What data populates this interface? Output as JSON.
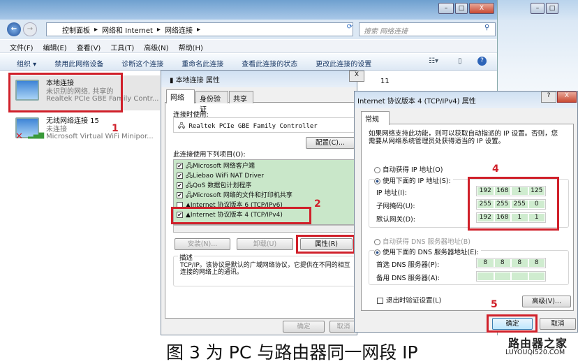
{
  "explorer": {
    "breadcrumb": [
      "控制面板",
      "网络和 Internet",
      "网络连接"
    ],
    "search_placeholder": "搜索 网络连接",
    "menu": [
      "文件(F)",
      "编辑(E)",
      "查看(V)",
      "工具(T)",
      "高级(N)",
      "帮助(H)"
    ],
    "toolbar": [
      "组织 ▾",
      "禁用此网络设备",
      "诊断这个连接",
      "重命名此连接",
      "查看此连接的状态",
      "更改此连接的设置"
    ],
    "connections": [
      {
        "name": "本地连接",
        "status": "未识别的网络, 共享的",
        "adapter": "Realtek PCIe GBE Family Contr..."
      },
      {
        "name": "无线网络连接 15",
        "status": "未连接",
        "adapter": "Microsoft Virtual WiFi Minipor..."
      }
    ],
    "partial_text": "11"
  },
  "properties_dialog": {
    "title": "本地连接 属性",
    "tabs": [
      "网络",
      "身份验证",
      "共享"
    ],
    "connect_using_label": "连接时使用:",
    "adapter": "Realtek PCIe GBE Family Controller",
    "configure_button": "配置(C)...",
    "items_label": "此连接使用下列项目(O):",
    "items": [
      {
        "label": "Microsoft 网络客户端",
        "checked": true
      },
      {
        "label": "Liebao WiFi NAT Driver",
        "checked": true
      },
      {
        "label": "QoS 数据包计划程序",
        "checked": true
      },
      {
        "label": "Microsoft 网络的文件和打印机共享",
        "checked": true
      },
      {
        "label": "Internet 协议版本 6 (TCP/IPv6)",
        "checked": false
      },
      {
        "label": "Internet 协议版本 4 (TCP/IPv4)",
        "checked": true
      }
    ],
    "install_button": "安装(N)...",
    "uninstall_button": "卸载(U)",
    "properties_button": "属性(R)",
    "description_label": "描述",
    "description": "TCP/IP。该协议是默认的广域网络协议，它提供在不同的相互连接的网络上的通讯。",
    "ok_button": "确定",
    "cancel_button": "取消"
  },
  "ipv4_dialog": {
    "title": "Internet 协议版本 4 (TCP/IPv4) 属性",
    "tab": "常规",
    "intro": "如果网络支持此功能，则可以获取自动指派的 IP 设置。否则，您需要从网络系统管理员处获得适当的 IP 设置。",
    "auto_ip": "自动获得 IP 地址(O)",
    "manual_ip": "使用下面的 IP 地址(S):",
    "ip_label": "IP 地址(I):",
    "ip": [
      "192",
      "168",
      "1",
      "125"
    ],
    "subnet_label": "子网掩码(U):",
    "subnet": [
      "255",
      "255",
      "255",
      "0"
    ],
    "gateway_label": "默认网关(D):",
    "gateway": [
      "192",
      "168",
      "1",
      "1"
    ],
    "auto_dns": "自动获得 DNS 服务器地址(B)",
    "manual_dns": "使用下面的 DNS 服务器地址(E):",
    "dns1_label": "首选 DNS 服务器(P):",
    "dns1": [
      "8",
      "8",
      "8",
      "8"
    ],
    "dns2_label": "备用 DNS 服务器(A):",
    "dns2": [
      "",
      "",
      "",
      ""
    ],
    "validate_label": "退出时验证设置(L)",
    "advanced_button": "高级(V)...",
    "ok_button": "确定",
    "cancel_button": "取消"
  },
  "annotations": {
    "step1": "1",
    "step2": "2",
    "step3": "3",
    "step4": "4",
    "step5": "5",
    "color": "#d0202a"
  },
  "caption": "图 3 为 PC 与路由器同一网段 IP",
  "watermark": {
    "name": "路由器之家",
    "url": "LUYOUQI520.COM"
  }
}
